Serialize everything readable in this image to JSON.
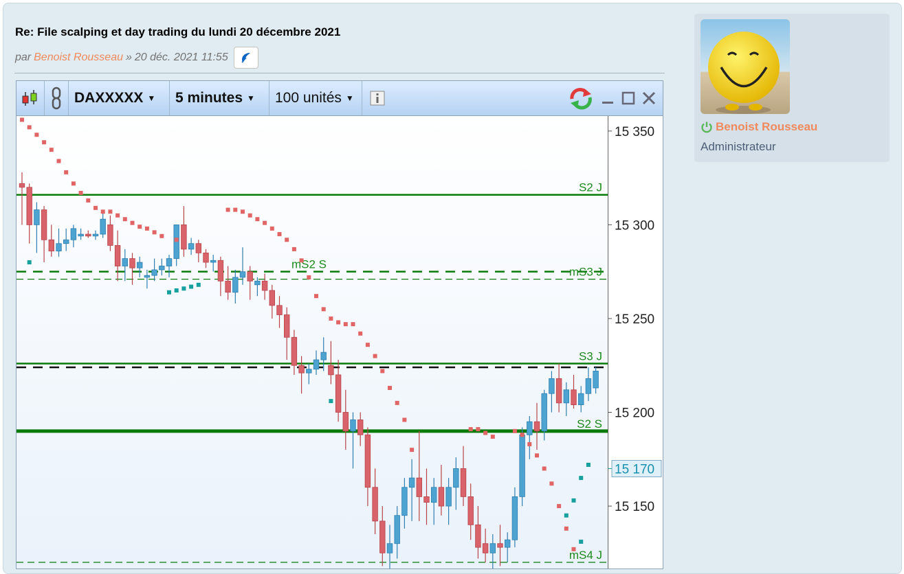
{
  "post": {
    "title": "Re: File scalping et day trading du lundi 20 décembre 2021",
    "by": "par",
    "author": "Benoist Rousseau",
    "sep": "»",
    "date": "20 déc. 2021 11:55"
  },
  "toolbar": {
    "instrument": "DAXXXXX",
    "interval": "5 minutes",
    "units": "100 unités"
  },
  "sidebar": {
    "username": "Benoist Rousseau",
    "role": "Administrateur"
  },
  "colors": {
    "bull": "#4ea4d1",
    "bear": "#d9636a",
    "pivot": "#0a7a0a",
    "sar_up": "#e26565",
    "sar_down": "#16a0a0"
  },
  "chart_data": {
    "type": "candlestick",
    "price_axis": {
      "ticks": [
        "15 350",
        "15 300",
        "15 250",
        "15 200",
        "15 150"
      ],
      "current_label": "15 170",
      "ymin": 15120,
      "ymax": 15358
    },
    "levels": [
      {
        "label": "S2 J",
        "price": 15316,
        "style": "solid"
      },
      {
        "label": "mS2 S",
        "price": 15275,
        "style": "dash-thick"
      },
      {
        "label": "mS3 J",
        "price": 15271,
        "style": "dash-thin"
      },
      {
        "label": "S3 J",
        "price": 15226,
        "style": "solid"
      },
      {
        "label": "",
        "price": 15224,
        "style": "dash-black"
      },
      {
        "label": "S2 S",
        "price": 15190,
        "style": "solid-thick"
      },
      {
        "label": "mS4 J",
        "price": 15120,
        "style": "dash-thin"
      }
    ],
    "candles": [
      [
        15322,
        15328,
        15300,
        15320
      ],
      [
        15320,
        15322,
        15290,
        15300
      ],
      [
        15300,
        15312,
        15285,
        15308
      ],
      [
        15308,
        15310,
        15280,
        15292
      ],
      [
        15292,
        15300,
        15283,
        15286
      ],
      [
        15286,
        15298,
        15283,
        15290
      ],
      [
        15290,
        15298,
        15286,
        15292
      ],
      [
        15292,
        15300,
        15288,
        15298
      ],
      [
        15294,
        15298,
        15292,
        15295
      ],
      [
        15295,
        15297,
        15293,
        15294
      ],
      [
        15294,
        15297,
        15292,
        15295
      ],
      [
        15295,
        15308,
        15293,
        15303
      ],
      [
        15300,
        15305,
        15286,
        15289
      ],
      [
        15289,
        15297,
        15270,
        15278
      ],
      [
        15278,
        15287,
        15270,
        15282
      ],
      [
        15282,
        15285,
        15268,
        15277
      ],
      [
        15277,
        15283,
        15272,
        15280
      ],
      [
        15272,
        15276,
        15266,
        15273
      ],
      [
        15273,
        15282,
        15270,
        15276
      ],
      [
        15276,
        15282,
        15273,
        15278
      ],
      [
        15278,
        15284,
        15272,
        15282
      ],
      [
        15282,
        15300,
        15278,
        15300
      ],
      [
        15300,
        15310,
        15283,
        15287
      ],
      [
        15287,
        15293,
        15284,
        15290
      ],
      [
        15290,
        15292,
        15280,
        15285
      ],
      [
        15285,
        15287,
        15277,
        15280
      ],
      [
        15280,
        15284,
        15275,
        15281
      ],
      [
        15281,
        15283,
        15262,
        15270
      ],
      [
        15270,
        15278,
        15260,
        15264
      ],
      [
        15264,
        15276,
        15258,
        15272
      ],
      [
        15272,
        15288,
        15268,
        15275
      ],
      [
        15275,
        15278,
        15260,
        15270
      ],
      [
        15268,
        15272,
        15262,
        15270
      ],
      [
        15270,
        15274,
        15260,
        15265
      ],
      [
        15265,
        15268,
        15250,
        15257
      ],
      [
        15257,
        15262,
        15245,
        15252
      ],
      [
        15252,
        15256,
        15228,
        15240
      ],
      [
        15240,
        15244,
        15220,
        15225
      ],
      [
        15225,
        15230,
        15210,
        15221
      ],
      [
        15221,
        15226,
        15215,
        15223
      ],
      [
        15223,
        15233,
        15220,
        15228
      ],
      [
        15228,
        15240,
        15222,
        15232
      ],
      [
        15225,
        15238,
        15215,
        15220
      ],
      [
        15220,
        15228,
        15195,
        15200
      ],
      [
        15200,
        15212,
        15180,
        15190
      ],
      [
        15190,
        15200,
        15170,
        15196
      ],
      [
        15196,
        15200,
        15182,
        15188
      ],
      [
        15188,
        15192,
        15150,
        15160
      ],
      [
        15160,
        15170,
        15135,
        15142
      ],
      [
        15142,
        15150,
        15118,
        15125
      ],
      [
        15125,
        15140,
        15110,
        15130
      ],
      [
        15130,
        15150,
        15122,
        15145
      ],
      [
        15145,
        15165,
        15138,
        15160
      ],
      [
        15160,
        15175,
        15142,
        15165
      ],
      [
        15165,
        15190,
        15142,
        15155
      ],
      [
        15155,
        15170,
        15140,
        15152
      ],
      [
        15152,
        15165,
        15140,
        15160
      ],
      [
        15160,
        15172,
        15145,
        15150
      ],
      [
        15150,
        15165,
        15140,
        15160
      ],
      [
        15160,
        15176,
        15148,
        15170
      ],
      [
        15170,
        15182,
        15150,
        15155
      ],
      [
        15155,
        15162,
        15132,
        15140
      ],
      [
        15140,
        15150,
        15122,
        15128
      ],
      [
        15130,
        15138,
        15120,
        15125
      ],
      [
        15125,
        15135,
        15115,
        15130
      ],
      [
        15130,
        15140,
        15118,
        15128
      ],
      [
        15128,
        15136,
        15120,
        15132
      ],
      [
        15132,
        15160,
        15128,
        15155
      ],
      [
        15155,
        15192,
        15150,
        15188
      ],
      [
        15188,
        15198,
        15175,
        15195
      ],
      [
        15195,
        15205,
        15180,
        15190
      ],
      [
        15190,
        15212,
        15185,
        15210
      ],
      [
        15210,
        15222,
        15200,
        15218
      ],
      [
        15218,
        15226,
        15200,
        15205
      ],
      [
        15205,
        15216,
        15198,
        15212
      ],
      [
        15212,
        15220,
        15202,
        15204
      ],
      [
        15204,
        15214,
        15200,
        15210
      ],
      [
        15210,
        15224,
        15206,
        15218
      ],
      [
        15213,
        15224,
        15210,
        15222
      ]
    ],
    "sar_upper": [
      [
        0,
        15356
      ],
      [
        1,
        15352
      ],
      [
        2,
        15348
      ],
      [
        3,
        15344
      ],
      [
        4,
        15340
      ],
      [
        5,
        15334
      ],
      [
        6,
        15328
      ],
      [
        7,
        15322
      ],
      [
        8,
        15317
      ],
      [
        9,
        15313
      ],
      [
        10,
        15309
      ],
      [
        11,
        15307
      ],
      [
        12,
        15307
      ],
      [
        13,
        15305
      ],
      [
        14,
        15303
      ],
      [
        15,
        15301
      ],
      [
        16,
        15299
      ],
      [
        17,
        15298
      ],
      [
        18,
        15296
      ],
      [
        19,
        15294
      ],
      [
        21,
        15292
      ],
      [
        28,
        15308
      ],
      [
        29,
        15308
      ],
      [
        30,
        15307
      ],
      [
        31,
        15305
      ],
      [
        32,
        15303
      ],
      [
        33,
        15301
      ],
      [
        34,
        15298
      ],
      [
        35,
        15295
      ],
      [
        36,
        15292
      ],
      [
        37,
        15287
      ],
      [
        38,
        15281
      ],
      [
        39,
        15272
      ],
      [
        40,
        15262
      ],
      [
        41,
        15255
      ],
      [
        42,
        15250
      ],
      [
        43,
        15248
      ],
      [
        44,
        15247
      ],
      [
        45,
        15247
      ],
      [
        46,
        15242
      ],
      [
        47,
        15236
      ],
      [
        48,
        15230
      ],
      [
        49,
        15222
      ],
      [
        50,
        15213
      ],
      [
        51,
        15205
      ],
      [
        52,
        15196
      ],
      [
        53,
        15180
      ],
      [
        54,
        15163
      ],
      [
        61,
        15191
      ],
      [
        62,
        15191
      ],
      [
        63,
        15189
      ],
      [
        64,
        15187
      ],
      [
        67,
        15190
      ],
      [
        68,
        15188
      ],
      [
        69,
        15183
      ],
      [
        70,
        15177
      ],
      [
        71,
        15170
      ],
      [
        72,
        15162
      ],
      [
        73,
        15150
      ],
      [
        74,
        15138
      ],
      [
        75,
        15127
      ]
    ],
    "sar_lower": [
      [
        1,
        15280
      ],
      [
        20,
        15264
      ],
      [
        21,
        15265
      ],
      [
        22,
        15266
      ],
      [
        23,
        15267
      ],
      [
        24,
        15268
      ],
      [
        42,
        15206
      ],
      [
        74,
        15145
      ],
      [
        75,
        15153
      ],
      [
        76,
        15165
      ],
      [
        77,
        15172
      ],
      [
        76,
        15131
      ]
    ]
  }
}
